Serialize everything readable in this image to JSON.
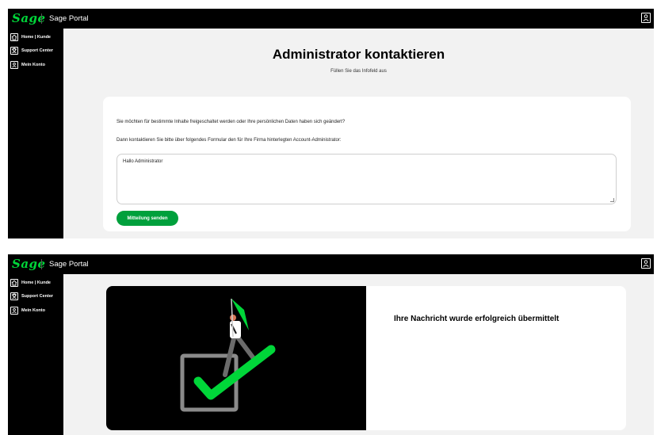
{
  "app": {
    "logo": "Sage",
    "portal_title": "Sage Portal"
  },
  "sidebar": {
    "items": [
      {
        "label": "Home | Kunde",
        "icon": "home-icon"
      },
      {
        "label": "Support Center",
        "icon": "support-icon"
      },
      {
        "label": "Mein Konto",
        "icon": "account-icon"
      }
    ]
  },
  "contact_form": {
    "title": "Administrator kontaktieren",
    "subtitle": "Füllen Sie das Infofeld aus",
    "intro_line_1": "Sie möchten für bestimmte Inhalte freigeschaltet werden oder Ihre persönlichen Daten haben sich geändert?",
    "intro_line_2": "Dann kontaktieren Sie bitte über folgendes Formular den für Ihre Firma hinterlegten Account-Administrator:",
    "message_value": "Hallo Administrator",
    "send_label": "Mitteilung senden"
  },
  "success": {
    "message": "Ihre Nachricht wurde erfolgreich übermittelt",
    "illustration_icon": "checkmark-flag-icon"
  },
  "colors": {
    "brand_green": "#00d639",
    "button_green": "#00a03c",
    "chrome_black": "#000000",
    "page_bg": "#f2f2f2"
  }
}
